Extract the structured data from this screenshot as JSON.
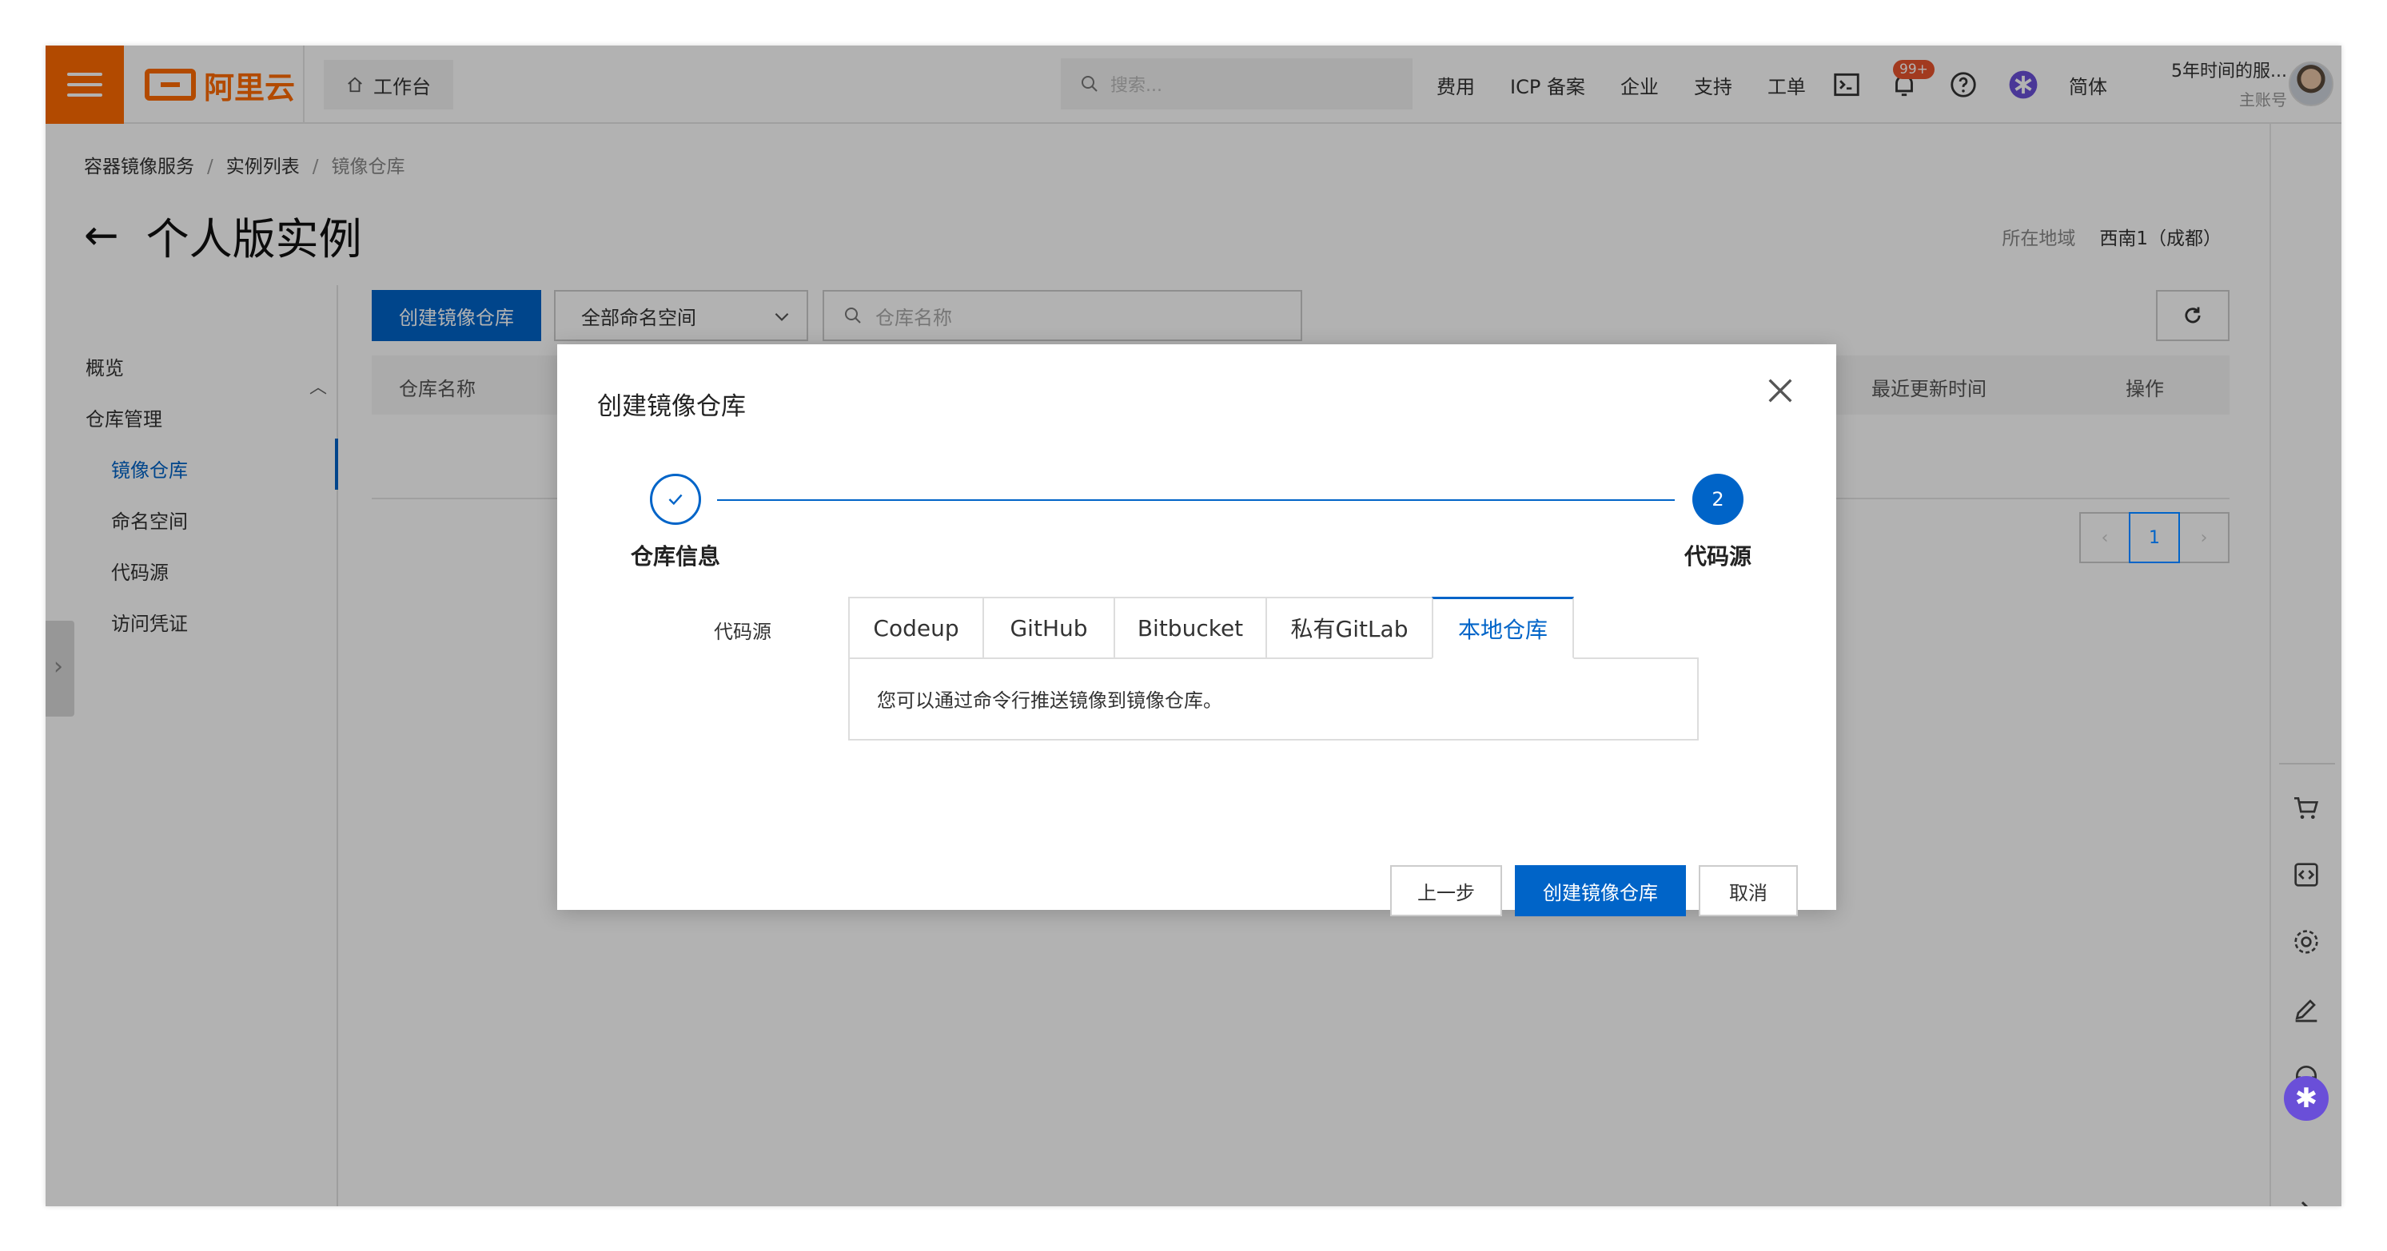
{
  "topbar": {
    "logo_text": "阿里云",
    "workbench": "工作台",
    "search_placeholder": "搜索...",
    "links": [
      "费用",
      "ICP 备案",
      "企业",
      "支持",
      "工单"
    ],
    "notification_badge": "99+",
    "language": "简体",
    "account_name": "5年时间的服...",
    "account_type": "主账号"
  },
  "breadcrumb": [
    "容器镜像服务",
    "实例列表",
    "镜像仓库"
  ],
  "page": {
    "title": "个人版实例",
    "region_label": "所在地域",
    "region_value": "西南1（成都）"
  },
  "sidebar": {
    "overview": "概览",
    "repo_mgmt": "仓库管理",
    "items": [
      "镜像仓库",
      "命名空间",
      "代码源",
      "访问凭证"
    ],
    "active_index": 0
  },
  "toolbar": {
    "create_label": "创建镜像仓库",
    "namespace_select": "全部命名空间",
    "repo_search_placeholder": "仓库名称"
  },
  "table": {
    "columns": [
      "仓库名称",
      "最近更新时间",
      "操作"
    ]
  },
  "pagination": {
    "current": "1"
  },
  "dialog": {
    "title": "创建镜像仓库",
    "steps": [
      {
        "label": "仓库信息",
        "status": "done"
      },
      {
        "label": "代码源",
        "number": "2",
        "status": "current"
      }
    ],
    "source_label": "代码源",
    "tabs": [
      "Codeup",
      "GitHub",
      "Bitbucket",
      "私有GitLab",
      "本地仓库"
    ],
    "active_tab": 4,
    "panel_text": "您可以通过命令行推送镜像到镜像仓库。",
    "buttons": {
      "prev": "上一步",
      "create": "创建镜像仓库",
      "cancel": "取消"
    }
  },
  "colors": {
    "brand": "#ff6a00",
    "primary": "#0064c8"
  }
}
